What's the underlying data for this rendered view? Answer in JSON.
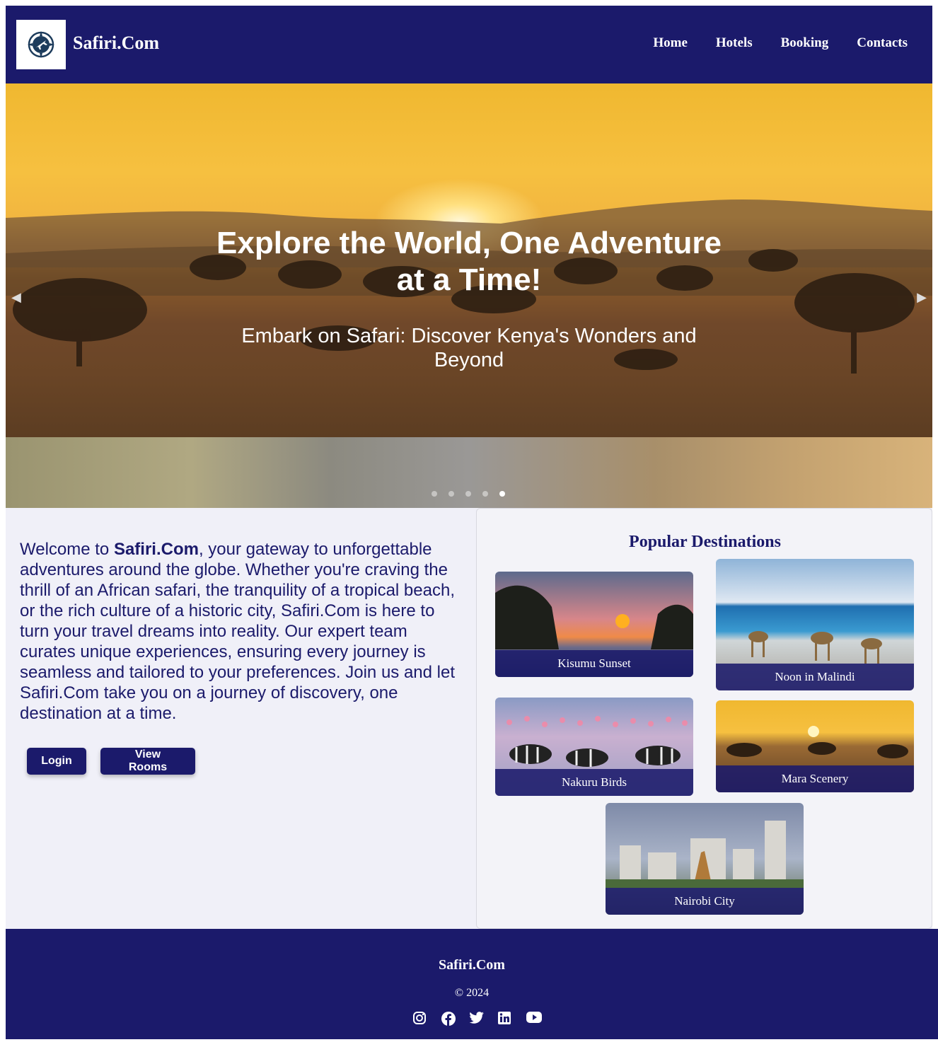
{
  "header": {
    "brand": "Safiri.Com",
    "nav": [
      "Home",
      "Hotels",
      "Booking",
      "Contacts"
    ],
    "logo_icon": "compass-plane-icon"
  },
  "hero": {
    "title": "Explore the World, One Adventure at a Time!",
    "subtitle": "Embark on Safari: Discover Kenya's Wonders and Beyond",
    "slide_count": 5,
    "active_slide": 5
  },
  "intro": {
    "prefix": "Welcome to ",
    "brand": "Safiri.Com",
    "body": ", your gateway to unforgettable adventures around the globe. Whether you're craving the thrill of an African safari, the tranquility of a tropical beach, or the rich culture of a historic city, Safiri.Com is here to turn your travel dreams into reality. Our expert team curates unique experiences, ensuring every journey is seamless and tailored to your preferences. Join us and let Safiri.Com take you on a journey of discovery, one destination at a time."
  },
  "buttons": {
    "login": "Login",
    "view_rooms": "View Rooms"
  },
  "destinations": {
    "title": "Popular Destinations",
    "items": [
      "Kisumu Sunset",
      "Noon in Malindi",
      "Nakuru Birds",
      "Mara Scenery",
      "Nairobi City"
    ]
  },
  "footer": {
    "brand": "Safiri.Com",
    "copyright": "© 2024",
    "socials": [
      "instagram-icon",
      "facebook-icon",
      "twitter-icon",
      "linkedin-icon",
      "youtube-icon"
    ]
  },
  "colors": {
    "brand_navy": "#1b1a6b",
    "panel_bg": "#f0f0f8"
  }
}
